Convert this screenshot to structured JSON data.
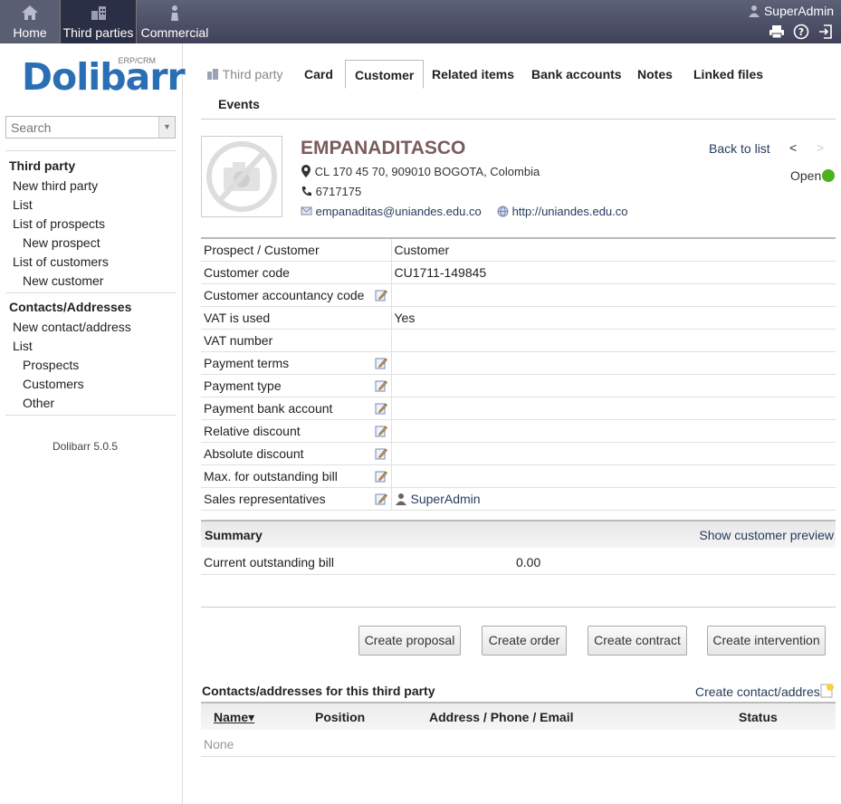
{
  "topbar": {
    "nav": [
      {
        "label": "Home",
        "icon": "home-icon"
      },
      {
        "label": "Third parties",
        "icon": "buildings-icon"
      },
      {
        "label": "Commercial",
        "icon": "briefcase-person-icon"
      }
    ],
    "user": "SuperAdmin",
    "icons": [
      "print-icon",
      "help-icon",
      "logout-icon"
    ]
  },
  "sidebar": {
    "logo_text": "Dolibarr",
    "logo_tag": "ERP/CRM",
    "search_placeholder": "Search",
    "section1": {
      "title": "Third party",
      "items": [
        "New third party",
        "List",
        "List of prospects",
        "New prospect",
        "List of customers",
        "New customer"
      ]
    },
    "section2": {
      "title": "Contacts/Addresses",
      "items": [
        "New contact/address",
        "List",
        "Prospects",
        "Customers",
        "Other"
      ]
    },
    "version": "Dolibarr 5.0.5"
  },
  "tabs": [
    "Third party",
    "Card",
    "Customer",
    "Related items",
    "Bank accounts",
    "Notes",
    "Linked files",
    "Events"
  ],
  "active_tab": "Customer",
  "company": {
    "name": "EMPANADITASCO",
    "address": "CL 170 45 70, 909010 BOGOTA, Colombia",
    "phone": "6717175",
    "email": "empanaditas@uniandes.edu.co",
    "url": "http://uniandes.edu.co",
    "back_to_list": "Back to list",
    "prev": "<",
    "next": ">",
    "status": "Open",
    "status_color": "#4bb21f"
  },
  "fields": [
    {
      "label": "Prospect / Customer",
      "value": "Customer",
      "editable": false
    },
    {
      "label": "Customer code",
      "value": "CU1711-149845",
      "editable": false
    },
    {
      "label": "Customer accountancy code",
      "value": "",
      "editable": true
    },
    {
      "label": "VAT is used",
      "value": "Yes",
      "editable": false
    },
    {
      "label": "VAT number",
      "value": "",
      "editable": false
    },
    {
      "label": "Payment terms",
      "value": "",
      "editable": true
    },
    {
      "label": "Payment type",
      "value": "",
      "editable": true
    },
    {
      "label": "Payment bank account",
      "value": "",
      "editable": true
    },
    {
      "label": "Relative discount",
      "value": "",
      "editable": true
    },
    {
      "label": "Absolute discount",
      "value": "",
      "editable": true
    },
    {
      "label": "Max. for outstanding bill",
      "value": "",
      "editable": true
    },
    {
      "label": "Sales representatives",
      "value": "SuperAdmin",
      "editable": true
    }
  ],
  "summary": {
    "title": "Summary",
    "preview_link": "Show customer preview",
    "outstanding_label": "Current outstanding bill",
    "outstanding_value": "0.00"
  },
  "buttons": [
    "Create proposal",
    "Create order",
    "Create contract",
    "Create intervention"
  ],
  "contacts": {
    "title": "Contacts/addresses for this third party",
    "create_link": "Create contact/address",
    "columns": [
      "Name",
      "Position",
      "Address / Phone / Email",
      "Status"
    ],
    "empty": "None"
  }
}
